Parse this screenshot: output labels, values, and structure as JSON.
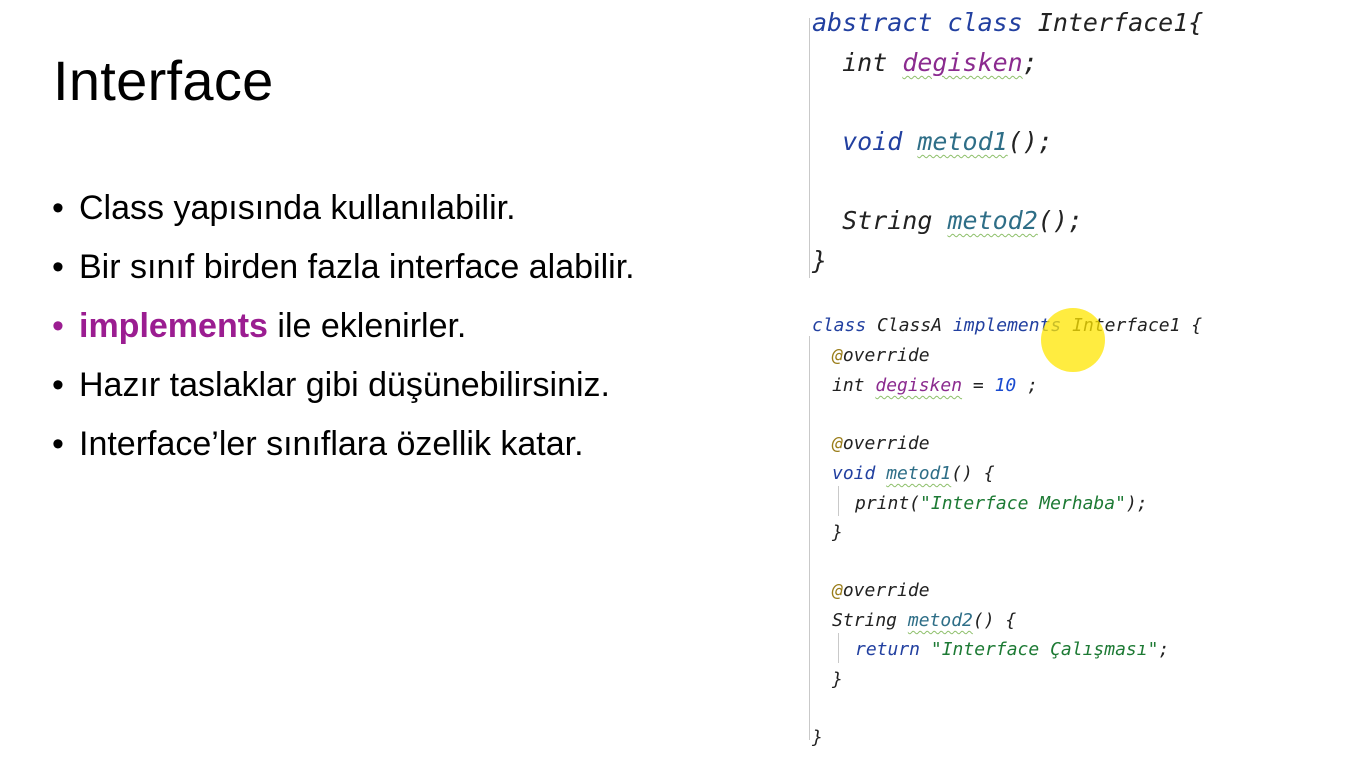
{
  "slide": {
    "title": "Interface",
    "bullets": [
      {
        "text": "Class yapısında kullanılabilir."
      },
      {
        "text": "Bir sınıf birden fazla interface alabilir."
      },
      {
        "highlight": "implements",
        "text": " ile eklenirler."
      },
      {
        "text": "Hazır taslaklar gibi düşünebilirsiniz."
      },
      {
        "text": "Interface’ler sınıflara özellik katar."
      }
    ]
  },
  "code_abstract": {
    "kw_abstract_class": "abstract class",
    "class_name": " Interface1{",
    "kw_int": "  int ",
    "field": "degisken",
    "semi": ";",
    "kw_void": "  void ",
    "method1": "metod1",
    "method1_sig": "();",
    "kw_string": "  String ",
    "method2": "metod2",
    "method2_sig": "();",
    "close": "}"
  },
  "code_class": {
    "kw_class": "class",
    "class_name": " ClassA ",
    "kw_implements": "implements",
    "iface": " Interface1 {",
    "ann": "@",
    "override": "override",
    "kw_int": "int ",
    "field": "degisken",
    "eq": " = ",
    "value": "10",
    "semi": " ;",
    "kw_void": "void ",
    "method1": "metod1",
    "m1_tail": "() {",
    "print": "print(",
    "str1": "\"Interface Merhaba\"",
    "print_tail": ");",
    "close_brace": "}",
    "kw_string": "String ",
    "method2": "metod2",
    "m2_tail": "() {",
    "kw_return": "return ",
    "str2": "\"Interface Çalışması\"",
    "ret_tail": ";"
  },
  "colors": {
    "accent": "#9b1d91",
    "keyword": "#2240a0",
    "string": "#1d7a34",
    "cursor_highlight": "#ffe600"
  }
}
